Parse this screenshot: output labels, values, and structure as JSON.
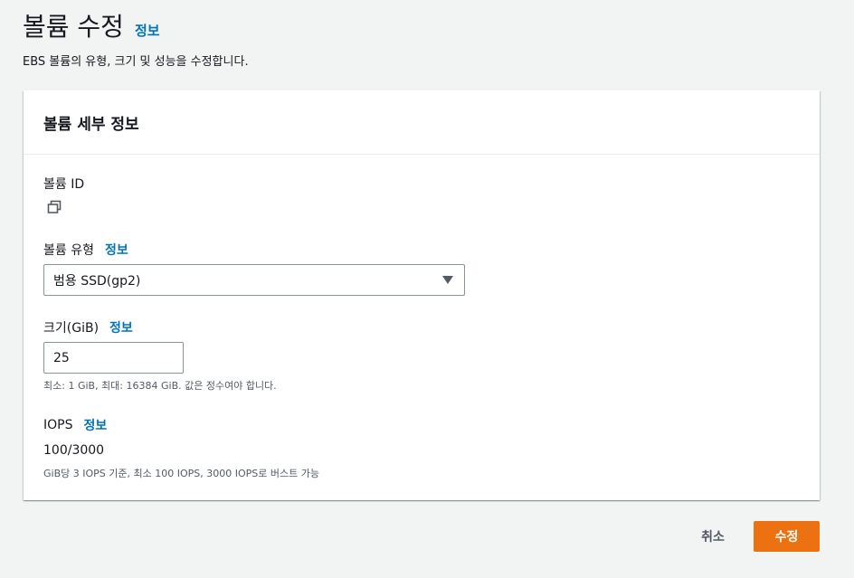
{
  "header": {
    "title": "볼륨 수정",
    "info": "정보",
    "description": "EBS 볼륨의 유형, 크기 및 성능을 수정합니다."
  },
  "panel": {
    "title": "볼륨 세부 정보",
    "volume_id": {
      "label": "볼륨 ID",
      "icon": "copy-icon"
    },
    "volume_type": {
      "label": "볼륨 유형",
      "info": "정보",
      "selected": "범용 SSD(gp2)"
    },
    "size": {
      "label": "크기(GiB)",
      "info": "정보",
      "value": "25",
      "hint": "최소: 1 GiB, 최대: 16384 GiB. 값은 정수여야 합니다."
    },
    "iops": {
      "label": "IOPS",
      "info": "정보",
      "value": "100/3000",
      "hint": "GiB당 3 IOPS 기준, 최소 100 IOPS, 3000 IOPS로 버스트 가능"
    }
  },
  "footer": {
    "cancel": "취소",
    "submit": "수정"
  },
  "colors": {
    "accent": "#ec7211",
    "link": "#0073bb",
    "background": "#f2f3f3"
  }
}
